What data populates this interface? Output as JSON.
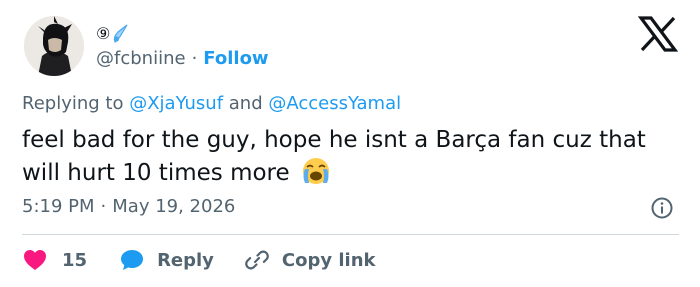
{
  "user": {
    "handle": "@fcbniine",
    "name_glyphs": [
      "⑨"
    ],
    "follow_label": "Follow"
  },
  "reply_context": {
    "prefix": "Replying to",
    "mention1": "@XjaYusuf",
    "conjunction": "and",
    "mention2": "@AccessYamal"
  },
  "tweet": {
    "text": "feel bad for the guy, hope he isnt a Barça fan cuz that will hurt 10 times more"
  },
  "meta": {
    "time": "5:19 PM",
    "separator": "·",
    "date": "May 19, 2026"
  },
  "actions": {
    "like_count": "15",
    "reply_label": "Reply",
    "copy_label": "Copy link"
  },
  "colors": {
    "accent": "#1d9bf0",
    "like": "#f91880",
    "muted": "#536471",
    "text": "#0f1419"
  },
  "icons": {
    "brand": "x-logo-icon",
    "like": "heart-icon",
    "reply": "speech-bubble-icon",
    "copy": "link-icon",
    "info": "info-icon",
    "emoji": "loudly-crying-face-emoji"
  }
}
